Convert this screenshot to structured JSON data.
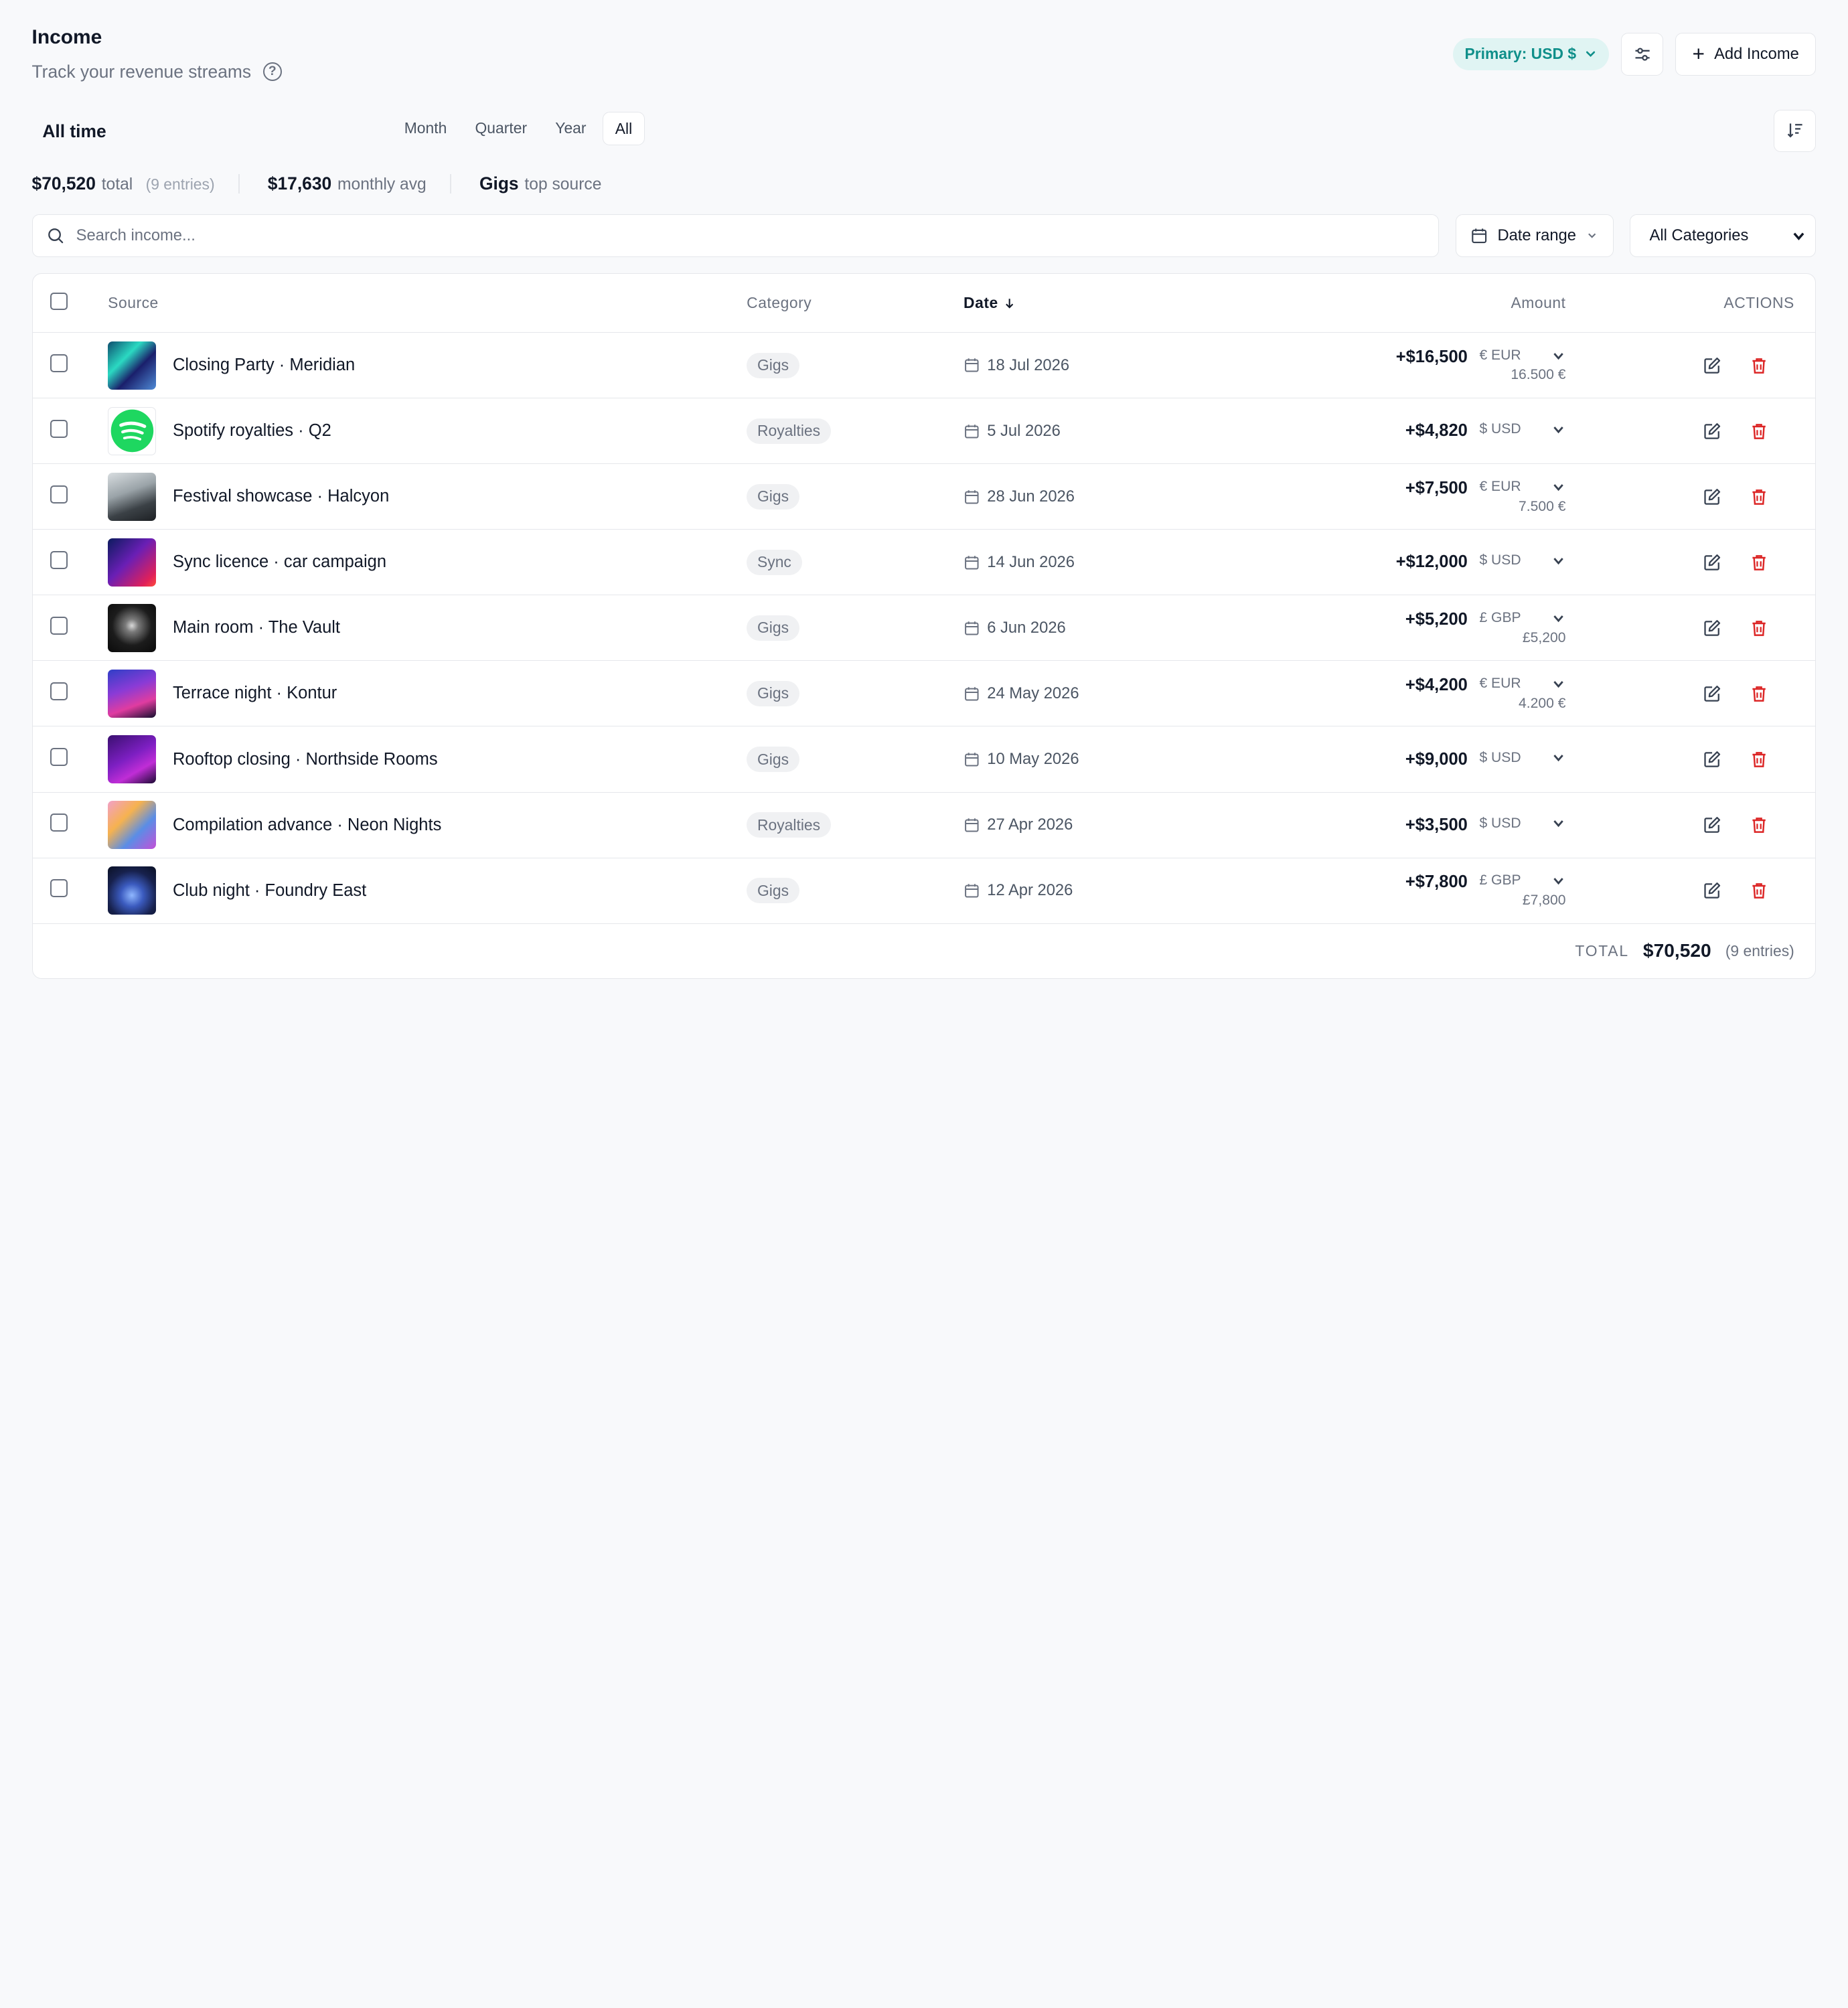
{
  "header": {
    "title": "Income",
    "subtitle": "Track your revenue streams",
    "primary_currency": "Primary: USD $",
    "add_label": "Add Income"
  },
  "period": {
    "label": "All time",
    "tabs": [
      "Month",
      "Quarter",
      "Year",
      "All"
    ],
    "active": "All"
  },
  "stats": {
    "total": "$70,520",
    "total_label": "total",
    "entries": "(9 entries)",
    "monthly_avg": "$17,630",
    "monthly_label": "monthly avg",
    "top_source": "Gigs",
    "top_label": "top source"
  },
  "filters": {
    "search_placeholder": "Search income...",
    "date_range": "Date range",
    "category": "All Categories"
  },
  "table": {
    "columns": {
      "source": "Source",
      "category": "Category",
      "date": "Date",
      "amount": "Amount",
      "actions": "ACTIONS"
    },
    "rows": [
      {
        "source": "Closing Party · Meridian",
        "category": "Gigs",
        "date": "18 Jul 2026",
        "amount": "+$16,500",
        "currency": "€ EUR",
        "original": "16.500 €"
      },
      {
        "source": "Spotify royalties · Q2",
        "category": "Royalties",
        "date": "5 Jul 2026",
        "amount": "+$4,820",
        "currency": "$ USD",
        "original": ""
      },
      {
        "source": "Festival showcase · Halcyon",
        "category": "Gigs",
        "date": "28 Jun 2026",
        "amount": "+$7,500",
        "currency": "€ EUR",
        "original": "7.500 €"
      },
      {
        "source": "Sync licence · car campaign",
        "category": "Sync",
        "date": "14 Jun 2026",
        "amount": "+$12,000",
        "currency": "$ USD",
        "original": ""
      },
      {
        "source": "Main room · The Vault",
        "category": "Gigs",
        "date": "6 Jun 2026",
        "amount": "+$5,200",
        "currency": "£ GBP",
        "original": "£5,200"
      },
      {
        "source": "Terrace night · Kontur",
        "category": "Gigs",
        "date": "24 May 2026",
        "amount": "+$4,200",
        "currency": "€ EUR",
        "original": "4.200 €"
      },
      {
        "source": "Rooftop closing · Northside Rooms",
        "category": "Gigs",
        "date": "10 May 2026",
        "amount": "+$9,000",
        "currency": "$ USD",
        "original": ""
      },
      {
        "source": "Compilation advance · Neon Nights",
        "category": "Royalties",
        "date": "27 Apr 2026",
        "amount": "+$3,500",
        "currency": "$ USD",
        "original": ""
      },
      {
        "source": "Club night · Foundry East",
        "category": "Gigs",
        "date": "12 Apr 2026",
        "amount": "+$7,800",
        "currency": "£ GBP",
        "original": "£7,800"
      }
    ],
    "footer": {
      "label": "TOTAL",
      "total": "$70,520",
      "entries": "(9 entries)"
    }
  },
  "colors": {
    "accent": "#0f8f8a",
    "danger": "#dc2626",
    "spotify": "#1ed760"
  }
}
